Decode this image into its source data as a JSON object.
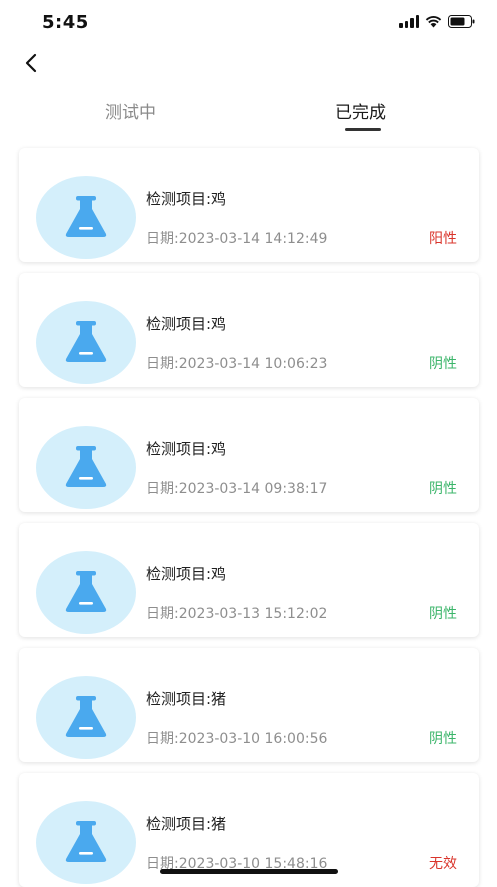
{
  "status_bar": {
    "time": "5:45"
  },
  "tabs": [
    {
      "label": "测试中",
      "active": false
    },
    {
      "label": "已完成",
      "active": true
    }
  ],
  "records": [
    {
      "project": "检测项目:鸡",
      "date": "日期:2023-03-14 14:12:49",
      "result": "阳性",
      "result_color": "#d9342b"
    },
    {
      "project": "检测项目:鸡",
      "date": "日期:2023-03-14 10:06:23",
      "result": "阴性",
      "result_color": "#3bb56a"
    },
    {
      "project": "检测项目:鸡",
      "date": "日期:2023-03-14 09:38:17",
      "result": "阴性",
      "result_color": "#3bb56a"
    },
    {
      "project": "检测项目:鸡",
      "date": "日期:2023-03-13 15:12:02",
      "result": "阴性",
      "result_color": "#3bb56a"
    },
    {
      "project": "检测项目:猪",
      "date": "日期:2023-03-10 16:00:56",
      "result": "阴性",
      "result_color": "#3bb56a"
    },
    {
      "project": "检测项目:猪",
      "date": "日期:2023-03-10 15:48:16",
      "result": "无效",
      "result_color": "#d9342b"
    }
  ],
  "colors": {
    "flask": "#4aa9ee",
    "avatar_bg": "#d4effb"
  }
}
